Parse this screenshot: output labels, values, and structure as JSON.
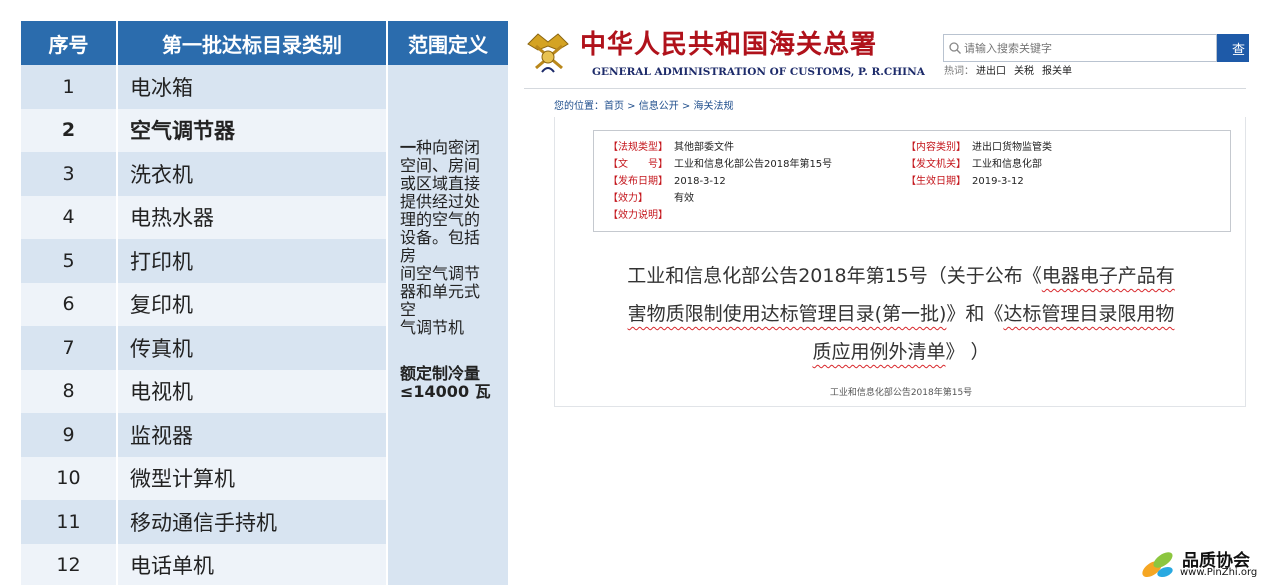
{
  "table": {
    "headers": {
      "no": "序号",
      "category": "第一批达标目录类别",
      "scope": "范围定义"
    },
    "rows": [
      {
        "no": "1",
        "name": "电冰箱"
      },
      {
        "no": "2",
        "name": "空气调节器"
      },
      {
        "no": "3",
        "name": "洗衣机"
      },
      {
        "no": "4",
        "name": "电热水器"
      },
      {
        "no": "5",
        "name": "打印机"
      },
      {
        "no": "6",
        "name": "复印机"
      },
      {
        "no": "7",
        "name": "传真机"
      },
      {
        "no": "8",
        "name": "电视机"
      },
      {
        "no": "9",
        "name": "监视器"
      },
      {
        "no": "10",
        "name": "微型计算机"
      },
      {
        "no": "11",
        "name": "移动通信手持机"
      },
      {
        "no": "12",
        "name": "电话单机"
      }
    ],
    "definition": {
      "lead": "一",
      "lines": [
        "种向密闭",
        "空间、房间",
        "或区域直接",
        "提供经过处",
        "理的空气的",
        "设备。包括",
        "房",
        "间空气调节",
        "器和单元式",
        "空",
        "气调节机"
      ],
      "rated_line1": "额定制冷量",
      "rated_line2": "≤14000 瓦"
    }
  },
  "site": {
    "title_cn": "中华人民共和国海关总署",
    "title_en": "GENERAL ADMINISTRATION OF CUSTOMS, P. R.CHINA",
    "search_placeholder": "请输入搜索关键字",
    "search_button": "查",
    "hot_label": "热词：",
    "hot_words": [
      "进出口",
      "关税",
      "报关单"
    ],
    "breadcrumb": {
      "prefix": "您的位置：",
      "items": [
        "首页",
        "信息公开",
        "海关法规"
      ],
      "sep": " > "
    },
    "meta": {
      "law_type_key": "【法规类型】",
      "law_type_val": "其他部委文件",
      "category_key": "【内容类别】",
      "category_val": "进出口货物监管类",
      "doc_no_key": "【文　　号】",
      "doc_no_val": "工业和信息化部公告2018年第15号",
      "issuer_key": "【发文机关】",
      "issuer_val": "工业和信息化部",
      "pub_date_key": "【发布日期】",
      "pub_date_val": "2018-3-12",
      "eff_date_key": "【生效日期】",
      "eff_date_val": "2019-3-12",
      "validity_key": "【效力】",
      "validity_val": "有效",
      "note_key": "【效力说明】"
    },
    "doc_title": {
      "part1": "工业和信息化部公告2018年第15号（关于公布《",
      "ul1a": "电器电子产品有",
      "ul1b": "害物质限制使用达标管理目录(第一批)",
      "part2": "》和《",
      "ul2a": "达标管理目录限用物",
      "ul2b": "质应用例外清单",
      "part3": "》 ）"
    },
    "doc_subtitle": "工业和信息化部公告2018年第15号"
  },
  "watermark": {
    "cn": "品质协会",
    "url": "www.PinZhi.org"
  }
}
